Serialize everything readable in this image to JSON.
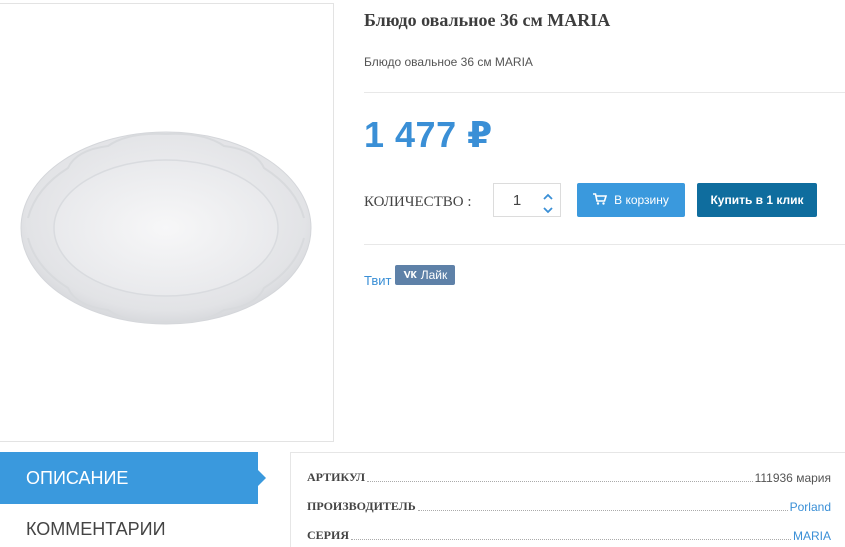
{
  "product": {
    "title": "Блюдо овальное 36 см MARIA",
    "subtitle": "Блюдо овальное 36 см MARIA",
    "price": "1 477 ₽",
    "image_alt": "oval-plate"
  },
  "purchase": {
    "qty_label": "КОЛИЧЕСТВО :",
    "qty_value": "1",
    "cart_label": "В корзину",
    "buy_label": "Купить в 1 клик"
  },
  "social": {
    "tweet": "Твит",
    "vk_like": "Лайк"
  },
  "tabs": [
    {
      "label": "ОПИСАНИЕ",
      "active": true
    },
    {
      "label": "КОММЕНТАРИИ",
      "active": false
    }
  ],
  "properties": [
    {
      "name": "АРТИКУЛ",
      "value": "111936 мария",
      "link": false
    },
    {
      "name": "ПРОИЗВОДИТЕЛЬ",
      "value": "Porland",
      "link": true
    },
    {
      "name": "СЕРИЯ",
      "value": "MARIA",
      "link": true
    }
  ],
  "colors": {
    "accent": "#3a99dd",
    "buy_button": "#0f6d9e",
    "price": "#3a8fd6",
    "vk": "#5e81a8"
  },
  "icons": {
    "cart": "shopping-cart-icon",
    "qty_up": "caret-up-icon",
    "qty_down": "caret-down-icon",
    "vk": "vk-logo-icon"
  }
}
